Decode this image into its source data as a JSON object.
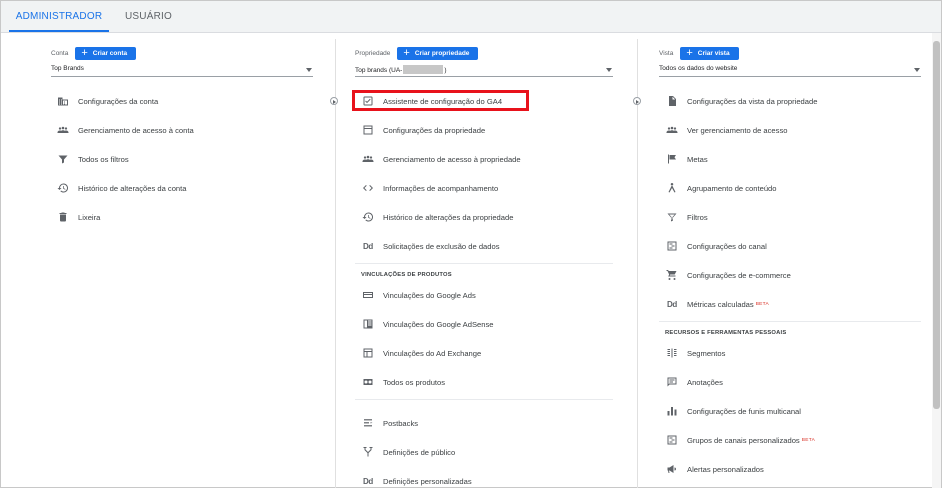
{
  "tabs": {
    "admin": "ADMINISTRADOR",
    "user": "USUÁRIO"
  },
  "account": {
    "label": "Conta",
    "create_button": "Criar conta",
    "selected": "Top Brands",
    "items": [
      {
        "icon": "building-icon",
        "label": "Configurações da conta"
      },
      {
        "icon": "people-icon",
        "label": "Gerenciamento de acesso à conta"
      },
      {
        "icon": "filter-icon",
        "label": "Todos os filtros"
      },
      {
        "icon": "history-icon",
        "label": "Histórico de alterações da conta"
      },
      {
        "icon": "trash-icon",
        "label": "Lixeira"
      }
    ]
  },
  "property": {
    "label": "Propriedade",
    "create_button": "Criar propriedade",
    "selected_prefix": "Top brands (UA-",
    "selected_suffix": ")",
    "items": [
      {
        "icon": "checkbox-icon",
        "label": "Assistente de configuração do GA4"
      },
      {
        "icon": "window-icon",
        "label": "Configurações da propriedade"
      },
      {
        "icon": "people-icon",
        "label": "Gerenciamento de acesso à propriedade"
      },
      {
        "icon": "code-icon",
        "label": "Informações de acompanhamento"
      },
      {
        "icon": "history-icon",
        "label": "Histórico de alterações da propriedade"
      },
      {
        "icon": "dd-icon",
        "label": "Solicitações de exclusão de dados"
      }
    ],
    "links_section_title": "VINCULAÇÕES DE PRODUTOS",
    "link_items": [
      {
        "icon": "google-ads-icon",
        "label": "Vinculações do Google Ads"
      },
      {
        "icon": "adsense-icon",
        "label": "Vinculações do Google AdSense"
      },
      {
        "icon": "ad-exchange-icon",
        "label": "Vinculações do Ad Exchange"
      },
      {
        "icon": "all-products-icon",
        "label": "Todos os produtos"
      }
    ],
    "other_items": [
      {
        "icon": "postbacks-icon",
        "label": "Postbacks"
      },
      {
        "icon": "audience-icon",
        "label": "Definições de público"
      },
      {
        "icon": "dd-icon",
        "label": "Definições personalizadas"
      }
    ]
  },
  "view": {
    "label": "Vista",
    "create_button": "Criar vista",
    "selected": "Todos os dados do website",
    "items": [
      {
        "icon": "document-icon",
        "label": "Configurações da vista da propriedade"
      },
      {
        "icon": "people-icon",
        "label": "Ver gerenciamento de acesso"
      },
      {
        "icon": "flag-icon",
        "label": "Metas"
      },
      {
        "icon": "content-grouping-icon",
        "label": "Agrupamento de conteúdo"
      },
      {
        "icon": "filter-icon",
        "label": "Filtros"
      },
      {
        "icon": "channel-settings-icon",
        "label": "Configurações do canal"
      },
      {
        "icon": "cart-icon",
        "label": "Configurações de e-commerce"
      },
      {
        "icon": "dd-icon",
        "label": "Métricas calculadas",
        "badge": "BETA"
      }
    ],
    "tools_section_title": "RECURSOS E FERRAMENTAS PESSOAIS",
    "tool_items": [
      {
        "icon": "segments-icon",
        "label": "Segmentos"
      },
      {
        "icon": "annotations-icon",
        "label": "Anotações"
      },
      {
        "icon": "bar-chart-icon",
        "label": "Configurações de funis multicanal"
      },
      {
        "icon": "channel-groups-icon",
        "label": "Grupos de canais personalizados",
        "badge": "BETA"
      },
      {
        "icon": "megaphone-icon",
        "label": "Alertas personalizados"
      }
    ]
  },
  "colors": {
    "accent": "#1a73e8",
    "highlight": "#e8121b"
  }
}
